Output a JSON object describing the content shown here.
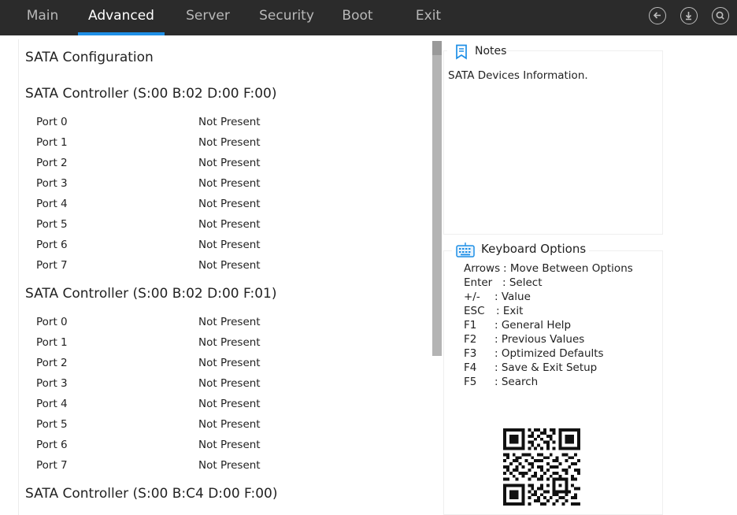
{
  "tabs": [
    {
      "label": "Main"
    },
    {
      "label": "Advanced"
    },
    {
      "label": "Server"
    },
    {
      "label": "Security"
    },
    {
      "label": "Boot"
    },
    {
      "label": "Exit"
    }
  ],
  "active_tab": "Advanced",
  "top_icons": [
    "back-icon",
    "save-download-icon",
    "search-icon"
  ],
  "page": {
    "title": "SATA Configuration",
    "controllers": [
      {
        "title": "SATA Controller (S:00 B:02 D:00 F:00)",
        "ports": [
          {
            "name": "Port 0",
            "status": "Not Present"
          },
          {
            "name": "Port 1",
            "status": "Not Present"
          },
          {
            "name": "Port 2",
            "status": "Not Present"
          },
          {
            "name": "Port 3",
            "status": "Not Present"
          },
          {
            "name": "Port 4",
            "status": "Not Present"
          },
          {
            "name": "Port 5",
            "status": "Not Present"
          },
          {
            "name": "Port 6",
            "status": "Not Present"
          },
          {
            "name": "Port 7",
            "status": "Not Present"
          }
        ]
      },
      {
        "title": "SATA Controller (S:00 B:02 D:00 F:01)",
        "ports": [
          {
            "name": "Port 0",
            "status": "Not Present"
          },
          {
            "name": "Port 1",
            "status": "Not Present"
          },
          {
            "name": "Port 2",
            "status": "Not Present"
          },
          {
            "name": "Port 3",
            "status": "Not Present"
          },
          {
            "name": "Port 4",
            "status": "Not Present"
          },
          {
            "name": "Port 5",
            "status": "Not Present"
          },
          {
            "name": "Port 6",
            "status": "Not Present"
          },
          {
            "name": "Port 7",
            "status": "Not Present"
          }
        ]
      },
      {
        "title": "SATA Controller (S:00 B:C4 D:00 F:00)",
        "ports": []
      }
    ]
  },
  "notes": {
    "title": "Notes",
    "text": "SATA Devices Information."
  },
  "keyboard": {
    "title": "Keyboard Options",
    "items": [
      {
        "key": "Arrows",
        "desc": ": Move Between Options"
      },
      {
        "key": "Enter",
        "desc": ": Select"
      },
      {
        "key": "+/-",
        "desc": ": Value"
      },
      {
        "key": "ESC",
        "desc": ": Exit"
      },
      {
        "key": "F1",
        "desc": ": General Help"
      },
      {
        "key": "F2",
        "desc": ": Previous Values"
      },
      {
        "key": "F3",
        "desc": ": Optimized Defaults"
      },
      {
        "key": "F4",
        "desc": ": Save & Exit Setup"
      },
      {
        "key": "F5",
        "desc": ": Search"
      }
    ]
  },
  "colors": {
    "topbar": "#2b2b2b",
    "accent": "#1e8fe6",
    "tab_inactive": "#b8b8b8",
    "scrollbar": "#b4b4b4"
  }
}
